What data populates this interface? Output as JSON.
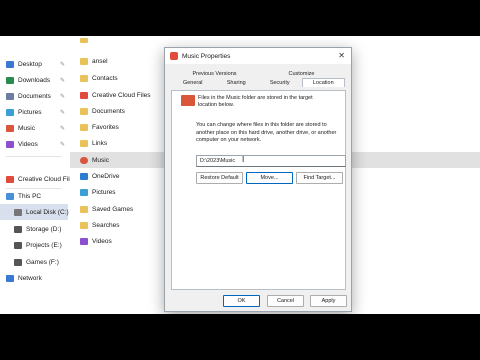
{
  "nav": {
    "pinned": [
      {
        "label": "Desktop",
        "icon": "desktop-icon",
        "color": "#3a78d4"
      },
      {
        "label": "Downloads",
        "icon": "downloads-icon",
        "color": "#2a8b4e"
      },
      {
        "label": "Documents",
        "icon": "documents-icon",
        "color": "#6c7ea0"
      },
      {
        "label": "Pictures",
        "icon": "pictures-icon",
        "color": "#3aa0d4"
      },
      {
        "label": "Music",
        "icon": "music-icon",
        "color": "#d9563a"
      },
      {
        "label": "Videos",
        "icon": "videos-icon",
        "color": "#8b4fd0"
      }
    ],
    "creative": "Creative Cloud Files",
    "this_pc": "This PC",
    "drives": [
      {
        "label": "Local Disk (C:)",
        "active": true
      },
      {
        "label": "Storage (D:)"
      },
      {
        "label": "Projects (E:)"
      },
      {
        "label": "Games (F:)"
      }
    ],
    "network": "Network"
  },
  "list": {
    "items": [
      "ansel",
      "Contacts",
      "Creative Cloud Files",
      "Documents",
      "Favorites",
      "Links",
      "Music",
      "OneDrive",
      "Pictures",
      "Saved Games",
      "Searches",
      "Videos"
    ]
  },
  "dialog": {
    "title": "Music Properties",
    "close": "✕",
    "tabs_top": [
      "Previous Versions",
      "Customize"
    ],
    "tabs_bottom": [
      "General",
      "Sharing",
      "Security",
      "Location"
    ],
    "header_text_1": "Files in the Music folder are stored in the target",
    "header_text_2": "location below.",
    "body_1": "You can change where files in this folder are stored to",
    "body_2": "another place on this hard drive, another drive, or another",
    "body_3": "computer on your network.",
    "path": "D:\\2023\\Music",
    "cursor": "I",
    "restore_label": "Restore Default",
    "move_label": "Move...",
    "find_label": "Find Target...",
    "ok_label": "OK",
    "cancel_label": "Cancel",
    "apply_label": "Apply"
  }
}
